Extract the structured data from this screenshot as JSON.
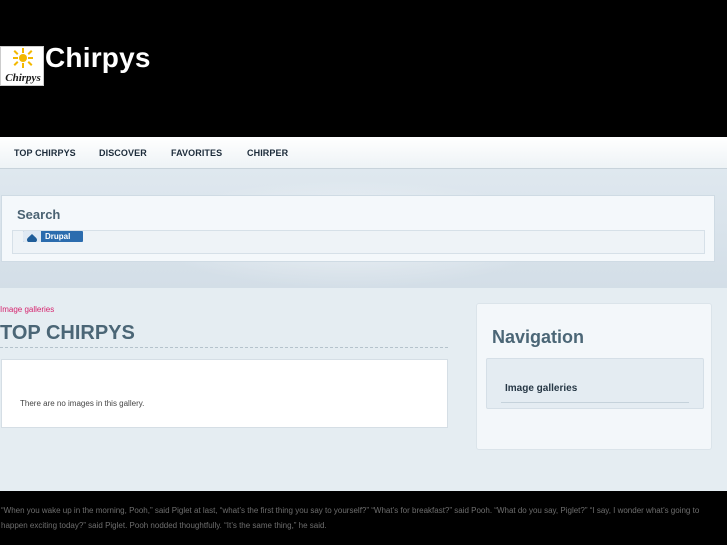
{
  "site": {
    "name": "Chirpys",
    "logo_text": "Chirpys"
  },
  "nav": {
    "items": [
      {
        "label": "TOP CHIRPYS"
      },
      {
        "label": "DISCOVER"
      },
      {
        "label": "FAVORITES"
      },
      {
        "label": "CHIRPER"
      }
    ]
  },
  "search": {
    "title": "Search",
    "badge_label": "Drupal"
  },
  "content": {
    "breadcrumb": "Image galleries",
    "title": "TOP CHIRPYS",
    "empty_message": "There are no images in this gallery."
  },
  "sidebar": {
    "title": "Navigation",
    "link": "Image galleries"
  },
  "footer": {
    "quote": "“When you wake up in the morning, Pooh,” said Piglet at last, “what’s the first thing you say to yourself?” “What’s for breakfast?” said Pooh. “What do you say, Piglet?” “I say, I wonder what’s going to happen exciting today?” said Piglet. Pooh nodded thoughtfully. “It’s the same thing,” he said."
  },
  "colors": {
    "header_bg": "#000000",
    "accent_link": "#d6246e",
    "title_color": "#4b6676",
    "badge_blue": "#2b6cae"
  }
}
